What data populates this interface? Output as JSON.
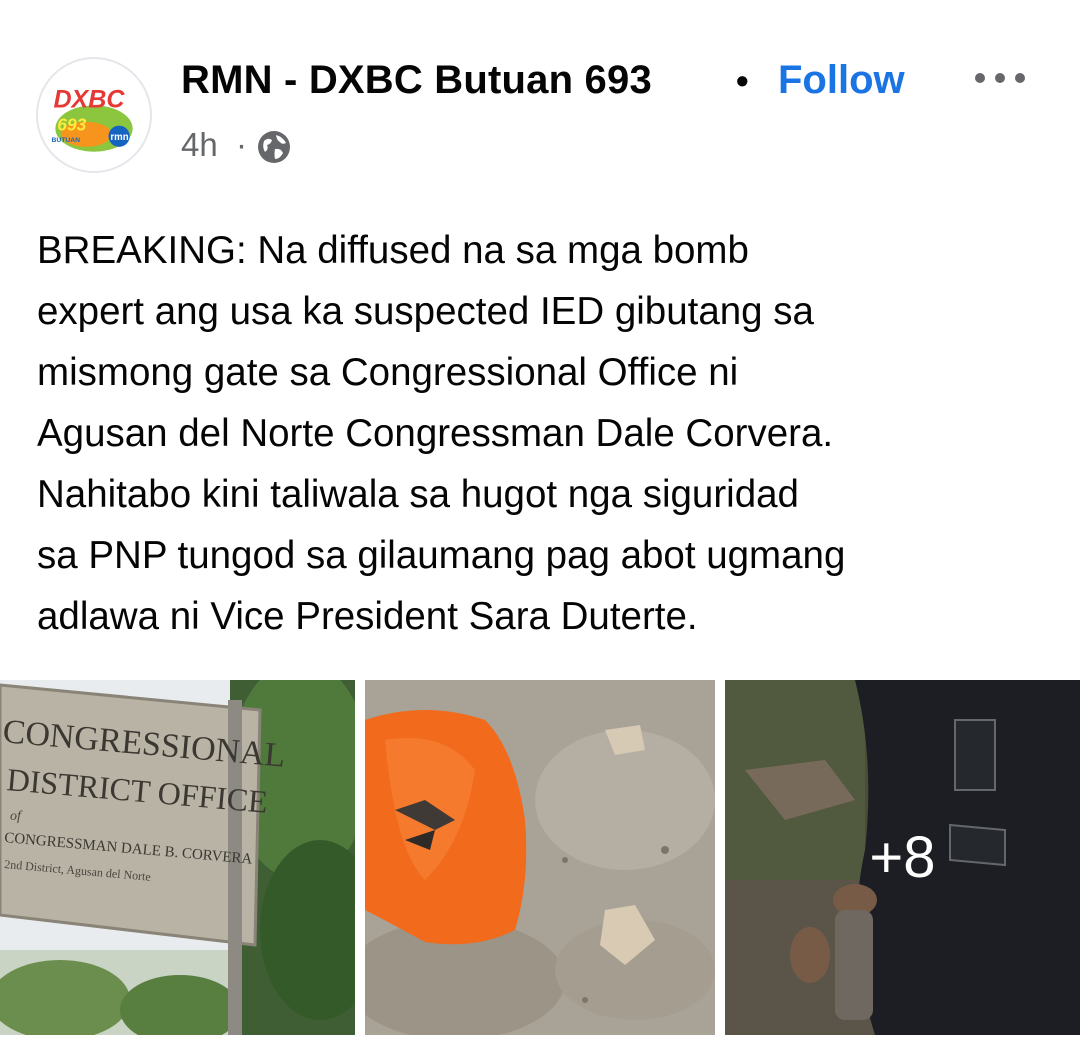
{
  "post": {
    "page_name": "RMN - DXBC Butuan 693",
    "separator": "•",
    "follow_label": "Follow",
    "time": "4h",
    "time_separator": "·",
    "privacy_icon": "globe-icon",
    "more_icon": "more-options-icon",
    "avatar": {
      "logo_text": "DXBC",
      "frequency": "693",
      "city": "BUTUAN",
      "network": "rmn"
    },
    "text": "BREAKING: Na diffused na sa mga bomb\nexpert ang usa ka suspected IED gibutang sa\nmismong gate sa Congressional Office ni\nAgusan del Norte Congressman Dale Corvera.\nNahitabo kini taliwala sa hugot nga siguridad\nsa PNP tungod sa gilaumang pag abot ugmang\nadlawa ni Vice President Sara Duterte.",
    "photos": [
      {
        "sign_line1": "CONGRESSIONAL",
        "sign_line2": "DISTRICT OFFICE",
        "sign_line3": "of",
        "sign_line4": "CONGRESSMAN DALE B. CORVERA",
        "sign_line5": "2nd District, Agusan del Norte"
      },
      {},
      {
        "overlay": "+8"
      }
    ]
  },
  "colors": {
    "accent": "#1b74e4",
    "secondary_text": "#65676b",
    "text": "#050505"
  }
}
